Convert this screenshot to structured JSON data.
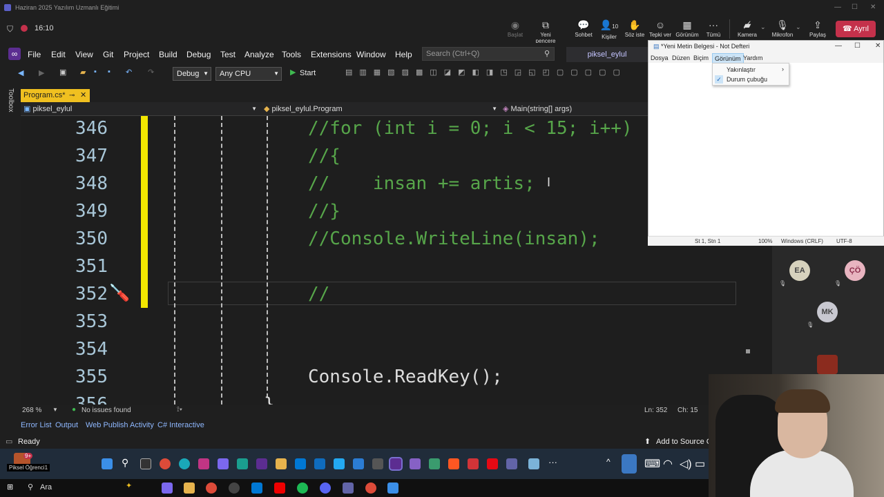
{
  "teams": {
    "window_title": "Haziran 2025 Yazılım Uzmanlı Eğitimi",
    "timer": "16:10",
    "toolbar": [
      {
        "label": "Başlat",
        "icon": "record-icon"
      },
      {
        "label": "Yeni pencere",
        "icon": "new-window-icon"
      },
      {
        "label": "Sohbet",
        "icon": "chat-icon"
      },
      {
        "label": "Kişiler",
        "icon": "people-icon",
        "count": "10"
      },
      {
        "label": "Söz iste",
        "icon": "raise-hand-icon"
      },
      {
        "label": "Tepki ver",
        "icon": "react-icon"
      },
      {
        "label": "Görünüm",
        "icon": "view-icon"
      },
      {
        "label": "Tümü",
        "icon": "more-icon"
      },
      {
        "label": "Kamera",
        "icon": "camera-off-icon"
      },
      {
        "label": "Mikrofon",
        "icon": "mic-off-icon"
      },
      {
        "label": "Paylaş",
        "icon": "share-icon"
      }
    ],
    "leave_label": "Ayrıl",
    "participants": [
      "EA",
      "ÇÖ",
      "MK"
    ],
    "self_label": "Piksel Öğrenci1",
    "notification_count": "9+"
  },
  "vs": {
    "menu": [
      "File",
      "Edit",
      "View",
      "Git",
      "Project",
      "Build",
      "Debug",
      "Test",
      "Analyze",
      "Tools",
      "Extensions",
      "Window",
      "Help"
    ],
    "search_placeholder": "Search (Ctrl+Q)",
    "project_name": "piksel_eylul",
    "config": "Debug",
    "platform": "Any CPU",
    "start_label": "Start",
    "toolbox_label": "Toolbox",
    "tab_label": "Program.cs*",
    "nav_project": "piksel_eylul",
    "nav_class": "piksel_eylul.Program",
    "nav_member": "Main(string[] args)",
    "lines": [
      {
        "num": "346",
        "text": "//for (int i = 0; i < 15; i++)"
      },
      {
        "num": "347",
        "text": "//{"
      },
      {
        "num": "348",
        "text": "//    insan += artis;"
      },
      {
        "num": "349",
        "text": "//}"
      },
      {
        "num": "350",
        "text": "//Console.WriteLine(insan);"
      },
      {
        "num": "351",
        "text": ""
      },
      {
        "num": "352",
        "text": "//"
      },
      {
        "num": "353",
        "text": ""
      },
      {
        "num": "354",
        "text": ""
      },
      {
        "num": "355",
        "text": "Console.ReadKey();"
      },
      {
        "num": "356",
        "text": "}"
      }
    ],
    "zoom": "268 %",
    "issues": "No issues found",
    "position_ln": "Ln: 352",
    "position_ch": "Ch: 15",
    "tool_tabs": [
      "Error List",
      "Output",
      "Web Publish Activity",
      "C# Interactive"
    ],
    "status": "Ready",
    "add_source": "Add to Source C"
  },
  "notepad": {
    "title": "*Yeni Metin Belgesi - Not Defteri",
    "menu": [
      "Dosya",
      "Düzen",
      "Biçim",
      "Görünüm",
      "Yardım"
    ],
    "popup": [
      "Yakınlaştır",
      "Durum çubuğu"
    ],
    "status": [
      "St 1, Stn 1",
      "100%",
      "Windows (CRLF)",
      "UTF-8"
    ]
  },
  "taskbar": {
    "search_label": "Ara"
  },
  "colors": {
    "accent_yellow": "#f2e600",
    "comment_green": "#57a64a",
    "leave_red": "#c4314b",
    "vs_purple": "#5c2d91"
  }
}
